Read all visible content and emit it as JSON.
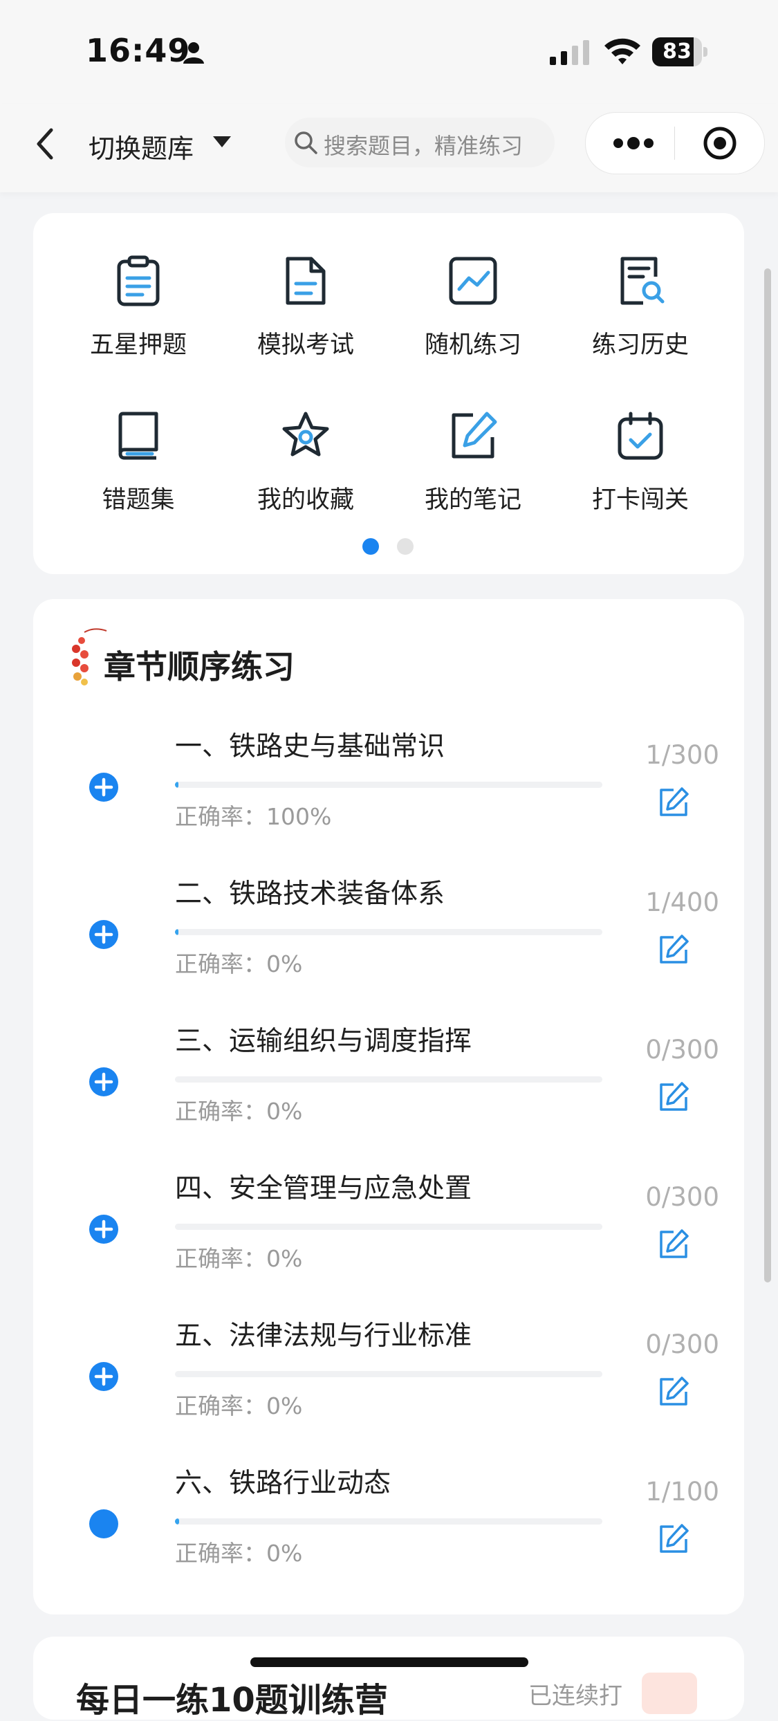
{
  "status": {
    "time": "16:49",
    "battery": "83",
    "battery_level": 0.83
  },
  "navbar": {
    "bank_label": "切换题库",
    "search_placeholder": "搜索题目，精准练习"
  },
  "tools": [
    {
      "label": "五星押题",
      "icon": "clipboard-icon"
    },
    {
      "label": "模拟考试",
      "icon": "document-icon"
    },
    {
      "label": "随机练习",
      "icon": "trend-chart-icon"
    },
    {
      "label": "练习历史",
      "icon": "history-search-icon"
    },
    {
      "label": "错题集",
      "icon": "book-icon"
    },
    {
      "label": "我的收藏",
      "icon": "star-icon"
    },
    {
      "label": "我的笔记",
      "icon": "note-edit-icon"
    },
    {
      "label": "打卡闯关",
      "icon": "calendar-check-icon"
    }
  ],
  "pager": {
    "page": 1,
    "total": 2
  },
  "chapters": {
    "title": "章节顺序练习",
    "accuracy_label": "正确率：",
    "items": [
      {
        "title": "一、铁路史与基础常识",
        "accuracy": "100%",
        "count": "1/300",
        "progress": 0.003,
        "icon": "plus-circle-icon"
      },
      {
        "title": "二、铁路技术装备体系",
        "accuracy": "0%",
        "count": "1/400",
        "progress": 0.0025,
        "icon": "plus-circle-icon"
      },
      {
        "title": "三、运输组织与调度指挥",
        "accuracy": "0%",
        "count": "0/300",
        "progress": 0,
        "icon": "plus-circle-icon"
      },
      {
        "title": "四、安全管理与应急处置",
        "accuracy": "0%",
        "count": "0/300",
        "progress": 0,
        "icon": "plus-circle-icon"
      },
      {
        "title": "五、法律法规与行业标准",
        "accuracy": "0%",
        "count": "0/300",
        "progress": 0,
        "icon": "plus-circle-icon"
      },
      {
        "title": "六、铁路行业动态",
        "accuracy": "0%",
        "count": "1/100",
        "progress": 0.01,
        "icon": "dot-circle-icon"
      }
    ]
  },
  "bottom": {
    "title": "每日一练10题训练营",
    "subtitle": "已连续打"
  },
  "colors": {
    "accent": "#1a84f0",
    "icon_blue": "#3aa0e6",
    "icon_dark": "#1f2a33"
  }
}
